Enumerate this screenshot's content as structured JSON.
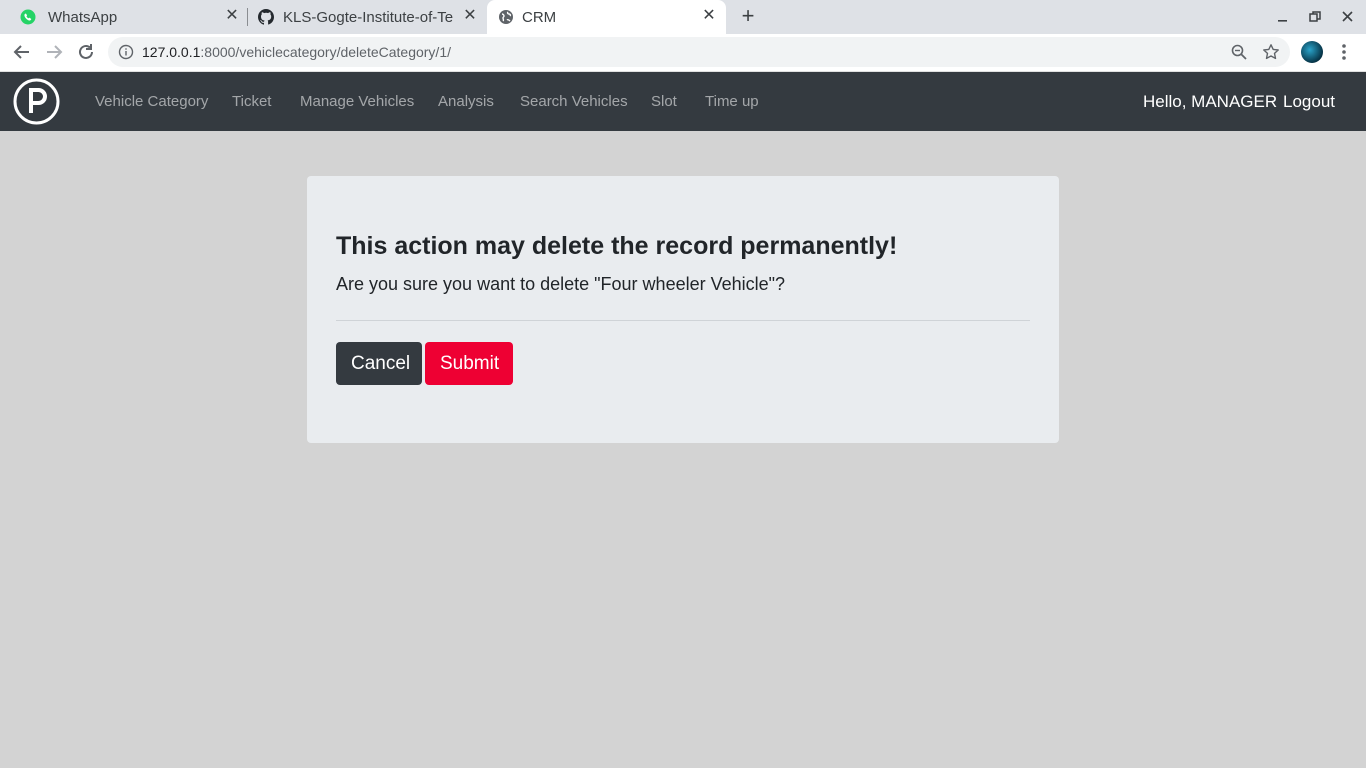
{
  "browser": {
    "tabs": [
      {
        "title": "WhatsApp",
        "icon": "whatsapp-icon"
      },
      {
        "title": "KLS-Gogte-Institute-of-Te",
        "icon": "github-icon"
      },
      {
        "title": "CRM",
        "icon": "globe-icon"
      }
    ],
    "url_host": "127.0.0.1",
    "url_rest": ":8000/vehiclecategory/deleteCategory/1/"
  },
  "navbar": {
    "links": [
      "Vehicle Category",
      "Ticket",
      "Manage Vehicles",
      "Analysis",
      "Search Vehicles",
      "Slot",
      "Time up"
    ],
    "greeting": "Hello, MANAGER",
    "logout": "Logout"
  },
  "dialog": {
    "heading": "This action may delete the record permanently!",
    "message": "Are you sure you want to delete \"Four wheeler Vehicle\"?",
    "cancel_label": "Cancel",
    "submit_label": "Submit"
  },
  "colors": {
    "page_bg": "#d3d3d3",
    "navbar_bg": "#343a40",
    "card_bg": "#e9ecef",
    "submit_bg": "#ee0033"
  }
}
